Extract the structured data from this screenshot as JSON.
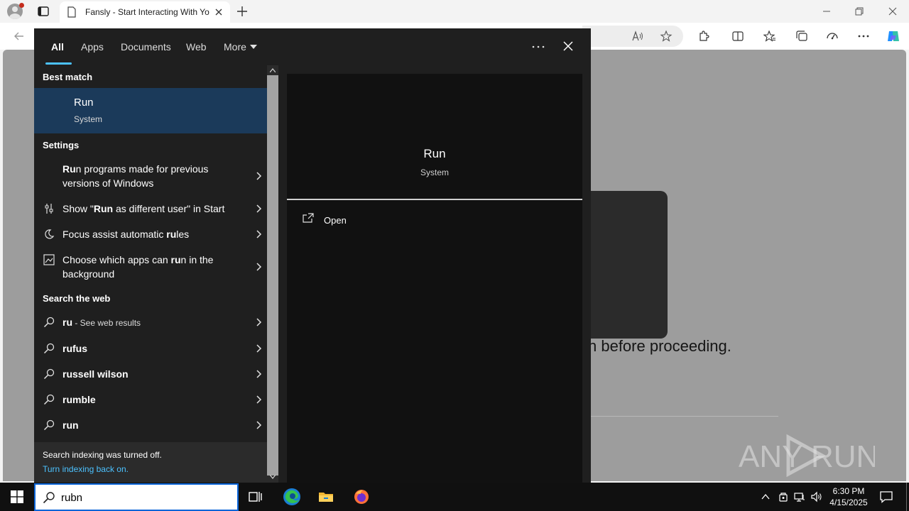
{
  "browser": {
    "tab_title": "Fansly - Start Interacting With Yo",
    "page_text": "n before proceeding."
  },
  "search": {
    "tabs": [
      {
        "label": "All"
      },
      {
        "label": "Apps"
      },
      {
        "label": "Documents"
      },
      {
        "label": "Web"
      },
      {
        "label": "More"
      }
    ],
    "best_match_header": "Best match",
    "best_match": {
      "title": "Run",
      "subtitle": "System"
    },
    "settings_header": "Settings",
    "settings_items": [
      {
        "bold": "Ru",
        "rest": "n programs made for previous versions of Windows",
        "icon": "blank"
      },
      {
        "prefix": "Show \"",
        "bold": "Run",
        "rest": " as different user\" in Start",
        "icon": "settings-slider-icon"
      },
      {
        "prefix": "Focus assist automatic ",
        "bold": "ru",
        "rest": "les",
        "icon": "moon-icon"
      },
      {
        "prefix": "Choose which apps can ",
        "bold": "ru",
        "rest": "n in the background",
        "icon": "background-apps-icon"
      }
    ],
    "web_header": "Search the web",
    "web_items": [
      {
        "query": "ru",
        "suffix": " - See web results"
      },
      {
        "query": "rufus",
        "suffix": ""
      },
      {
        "query": "russell wilson",
        "suffix": ""
      },
      {
        "query": "rumble",
        "suffix": ""
      },
      {
        "query": "run",
        "suffix": ""
      }
    ],
    "footer_status": "Search indexing was turned off.",
    "footer_link": "Turn indexing back on.",
    "detail": {
      "title": "Run",
      "subtitle": "System",
      "action": "Open"
    },
    "query": "rubn"
  },
  "taskbar": {
    "time": "6:30 PM",
    "date": "4/15/2025"
  },
  "watermark": {
    "text": "ANY RUN"
  },
  "colors": {
    "accent": "#4cc2ff",
    "selected": "#1b3a5a",
    "flyout_bg": "#1f1f1f",
    "taskbar_bg": "#101010"
  }
}
